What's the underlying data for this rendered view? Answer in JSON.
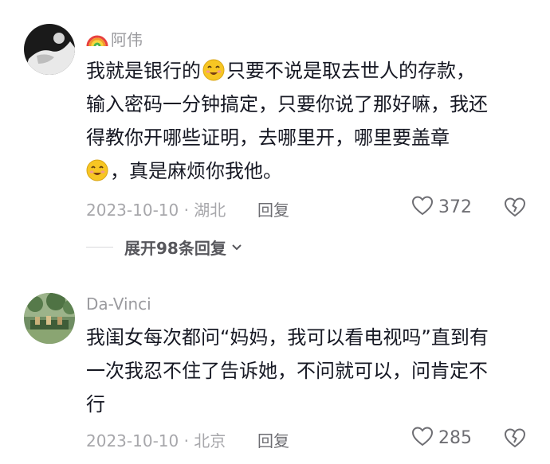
{
  "comments": [
    {
      "username": "阿伟",
      "text_lines": [
        {
          "before": "我就是银行的",
          "emoji_inline": true,
          "after": "只要不说是取去世人的存款，"
        },
        {
          "text": "输入密码一分钟搞定，只要你说了那好嘛，我还"
        },
        {
          "text": "得教你开哪些证明，去哪里开，哪里要盖章"
        },
        {
          "leading_emoji": true,
          "text": "，真是麻烦你我他。"
        }
      ],
      "meta": "2023-10-10 · 湖北",
      "reply_label": "回复",
      "like_count": "372",
      "expand_label": "展开98条回复"
    },
    {
      "username": "Da-Vinci",
      "text_lines": [
        {
          "text": "我闺女每次都问“妈妈，我可以看电视吗”直到有"
        },
        {
          "text": "一次我忍不住了告诉她，不问就可以，问肯定不"
        },
        {
          "text": "行"
        }
      ],
      "meta": "2023-10-10 · 北京",
      "reply_label": "回复",
      "like_count": "285"
    }
  ],
  "icons": {
    "rainbow": "rainbow-emoji",
    "emoji": "smiling-face-emoji",
    "like": "heart-outline-icon",
    "dislike": "broken-heart-icon",
    "chevron": "chevron-down-icon"
  },
  "colors": {
    "text": "#161823",
    "muted": "#a7a7ab",
    "emoji_face": "#f7c623"
  }
}
